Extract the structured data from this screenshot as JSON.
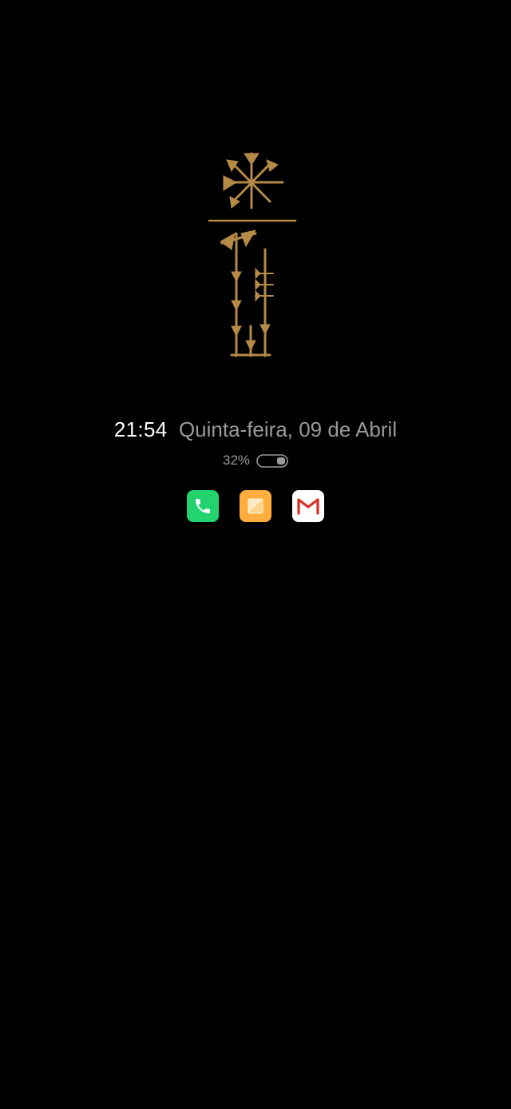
{
  "lockscreen": {
    "time": "21:54",
    "date": "Quinta-feira, 09 de Abril",
    "battery_percent": "32%",
    "battery_level": 0.32,
    "wallpaper_art": "gold-cuneiform-glyphs"
  },
  "notification_apps": [
    {
      "name": "phone-app-icon",
      "icon": "phone-icon",
      "color": "#22d36e"
    },
    {
      "name": "notes-app-icon",
      "icon": "notes-icon",
      "color": "#ffae3d"
    },
    {
      "name": "gmail-app-icon",
      "icon": "gmail-icon",
      "color": "#ffffff"
    }
  ],
  "colors": {
    "background": "#000000",
    "time_text": "#ffffff",
    "secondary_text": "#9a9a9a",
    "art_gold": "#b48a46"
  }
}
